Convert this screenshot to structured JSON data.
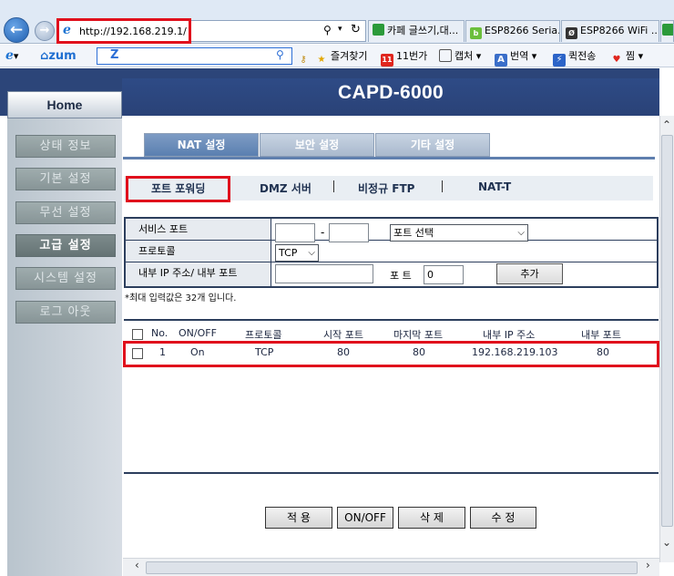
{
  "browser": {
    "url": "http://192.168.219.1/",
    "tabs": [
      {
        "label": "카페 글쓰기,대..."
      },
      {
        "label": "ESP8266 Seria..."
      },
      {
        "label": "ESP8266 WiFi ..."
      }
    ],
    "toolbar": {
      "brand": "zum",
      "search_logo": "Z",
      "favorites": "즐겨찾기",
      "shop": "11번가",
      "capture": "캡처",
      "translate": "번역",
      "delivery": "퀵전송",
      "wishlist": "찜"
    }
  },
  "app": {
    "title": "CAPD-6000",
    "home_label": "Home"
  },
  "sidebar": {
    "items": [
      {
        "label": "상태 정보"
      },
      {
        "label": "기본 설정"
      },
      {
        "label": "무선 설정"
      },
      {
        "label": "고급 설정"
      },
      {
        "label": "시스템 설정"
      },
      {
        "label": "로그 아웃"
      }
    ]
  },
  "main_tabs": [
    {
      "label": "NAT 설정"
    },
    {
      "label": "보안 설정"
    },
    {
      "label": "기타 설정"
    }
  ],
  "sub_tabs": [
    {
      "label": "포트 포워딩"
    },
    {
      "label": "DMZ 서버"
    },
    {
      "label": "비정규 FTP"
    },
    {
      "label": "NAT-T"
    }
  ],
  "form": {
    "service_port_label": "서비스 포트",
    "range_dash": "-",
    "port_select_value": "포트 선택",
    "protocol_label": "프로토콜",
    "protocol_value": "TCP",
    "internal_label": "내부 IP 주소/ 내부 포트",
    "port_label": "포 트",
    "port_value": "0",
    "add_button": "추가",
    "note": "*최대 입력값은 32개 입니다."
  },
  "table": {
    "headers": [
      "No.",
      "ON/OFF",
      "프로토콜",
      "시작 포트",
      "마지막 포트",
      "내부 IP 주소",
      "내부 포트"
    ],
    "rows": [
      [
        "1",
        "On",
        "TCP",
        "80",
        "80",
        "192.168.219.103",
        "80"
      ]
    ]
  },
  "actions": {
    "apply": "적 용",
    "onoff": "ON/OFF",
    "delete": "삭 제",
    "edit": "수 정"
  },
  "colors": {
    "banner": "#2c4579",
    "highlight": "#e0101c",
    "sidebar_button": "#8a9899"
  }
}
